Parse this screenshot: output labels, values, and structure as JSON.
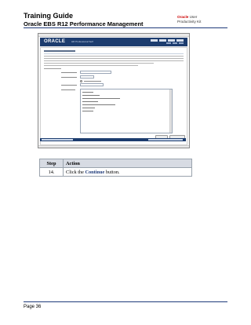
{
  "header": {
    "title": "Training Guide",
    "subtitle": "Oracle EBS R12 Performance Management",
    "brand_oracle": "Oracle",
    "brand_user": "User",
    "brand_kit": "Productivity Kit"
  },
  "screenshot": {
    "logo": "ORACLE",
    "module": "HR Professional Self",
    "step_buttons": [
      "Cancel",
      "Continue"
    ]
  },
  "table": {
    "headers": [
      "Step",
      "Action"
    ],
    "rows": [
      {
        "step": "14.",
        "pre": "Click the ",
        "emph": "Continue",
        "post": " button."
      }
    ]
  },
  "footer": {
    "page": "Page 36"
  }
}
